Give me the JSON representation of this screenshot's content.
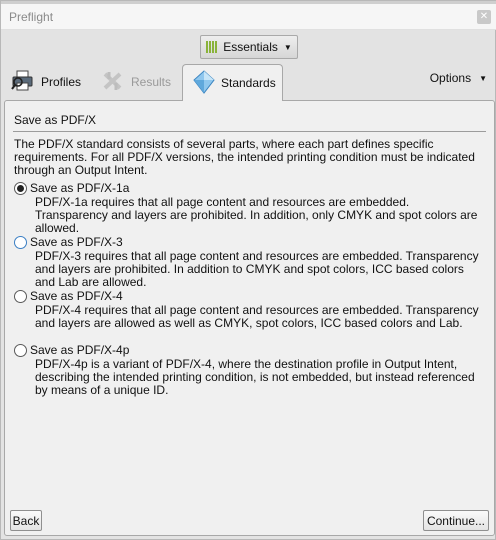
{
  "window": {
    "title": "Preflight"
  },
  "toolbar": {
    "essentials_label": "Essentials"
  },
  "tabs": {
    "profiles": "Profiles",
    "results": "Results",
    "standards": "Standards",
    "options": "Options"
  },
  "panel": {
    "heading": "Save as PDF/X",
    "intro": "The PDF/X standard consists of several parts, where each part defines specific requirements. For all PDF/X versions, the intended printing condition must be indicated through an Output Intent.",
    "options": [
      {
        "label": "Save as PDF/X-1a",
        "selected": true,
        "description": "PDF/X-1a requires that all page content and resources are embedded. Transparency and layers are prohibited. In addition, only CMYK and spot colors are allowed."
      },
      {
        "label": "Save as PDF/X-3",
        "selected": false,
        "description": "PDF/X-3 requires that all page content and resources are embedded. Transparency and layers are prohibited. In addition to CMYK and spot colors, ICC based colors and Lab are allowed."
      },
      {
        "label": "Save as PDF/X-4",
        "selected": false,
        "description": "PDF/X-4 requires that all page content and resources are embedded. Transparency and layers are allowed as well as CMYK, spot colors, ICC based colors and Lab."
      },
      {
        "label": "Save as PDF/X-4p",
        "selected": false,
        "description": "PDF/X-4p is a variant of PDF/X-4, where the destination profile in Output Intent, describing the intended printing condition, is not embedded, but instead referenced by means of a unique ID."
      }
    ]
  },
  "buttons": {
    "back": "Back",
    "continue": "Continue..."
  },
  "colors": {
    "accent_green": "#8ab33a",
    "radio_blue": "#3b7fc4",
    "panel_bg": "#f0f0f0"
  },
  "icons": [
    "close-icon",
    "essentials-icon",
    "printer-icon",
    "results-icon",
    "standards-icon",
    "chevron-down-icon"
  ]
}
